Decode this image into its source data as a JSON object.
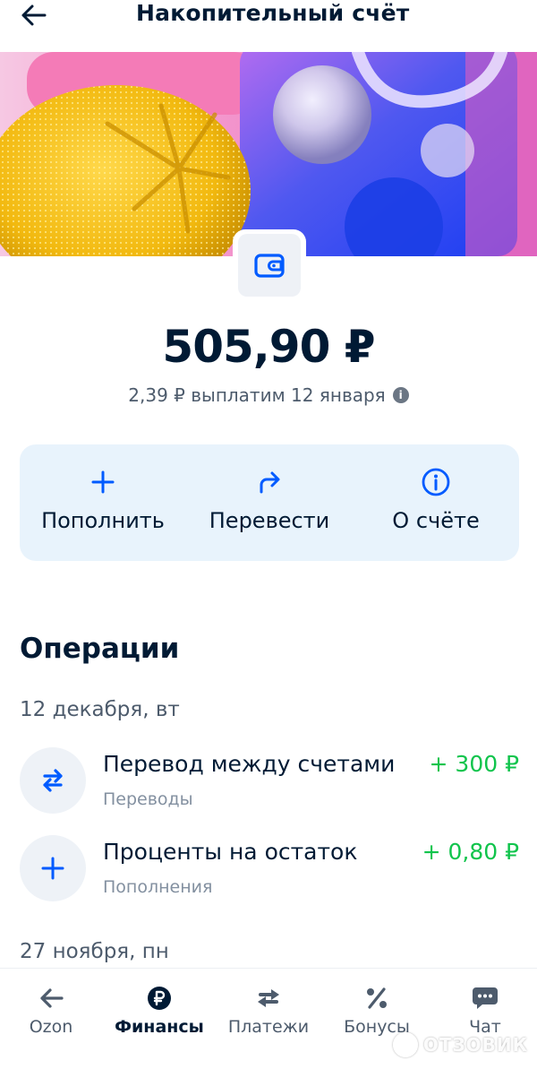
{
  "header": {
    "title": "Накопительный счёт",
    "back_icon": "arrow-left-icon"
  },
  "account": {
    "icon": "wallet-icon",
    "balance": "505,90 ₽",
    "payout": "2,39 ₽ выплатим 12 января",
    "payout_info_icon": "info-icon"
  },
  "actions": [
    {
      "label": "Пополнить",
      "icon": "plus-icon"
    },
    {
      "label": "Перевести",
      "icon": "redo-arrow-icon"
    },
    {
      "label": "О счёте",
      "icon": "info-circle-icon"
    }
  ],
  "operations": {
    "title": "Операции",
    "groups": [
      {
        "date": "12 декабря, вт",
        "items": [
          {
            "name": "Перевод между счетами",
            "category": "Переводы",
            "amount": "+ 300 ₽",
            "icon": "transfer-arrows-icon"
          },
          {
            "name": "Проценты на остаток",
            "category": "Пополнения",
            "amount": "+ 0,80 ₽",
            "icon": "plus-icon"
          }
        ]
      },
      {
        "date": "27 ноября, пн",
        "items": []
      }
    ]
  },
  "tabbar": {
    "active": "Финансы",
    "tabs": [
      {
        "label": "Ozon",
        "icon": "arrow-left-icon"
      },
      {
        "label": "Финансы",
        "icon": "ruble-coin-icon"
      },
      {
        "label": "Платежи",
        "icon": "swap-arrows-icon"
      },
      {
        "label": "Бонусы",
        "icon": "percent-icon"
      },
      {
        "label": "Чат",
        "icon": "chat-bubble-icon"
      }
    ]
  },
  "watermark": "ОТЗОВИК",
  "colors": {
    "accent_blue": "#005bff",
    "positive_green": "#10c44c",
    "text_primary": "#001a34",
    "text_secondary": "#4d5b6c",
    "actions_bg": "#e8f3fc"
  }
}
